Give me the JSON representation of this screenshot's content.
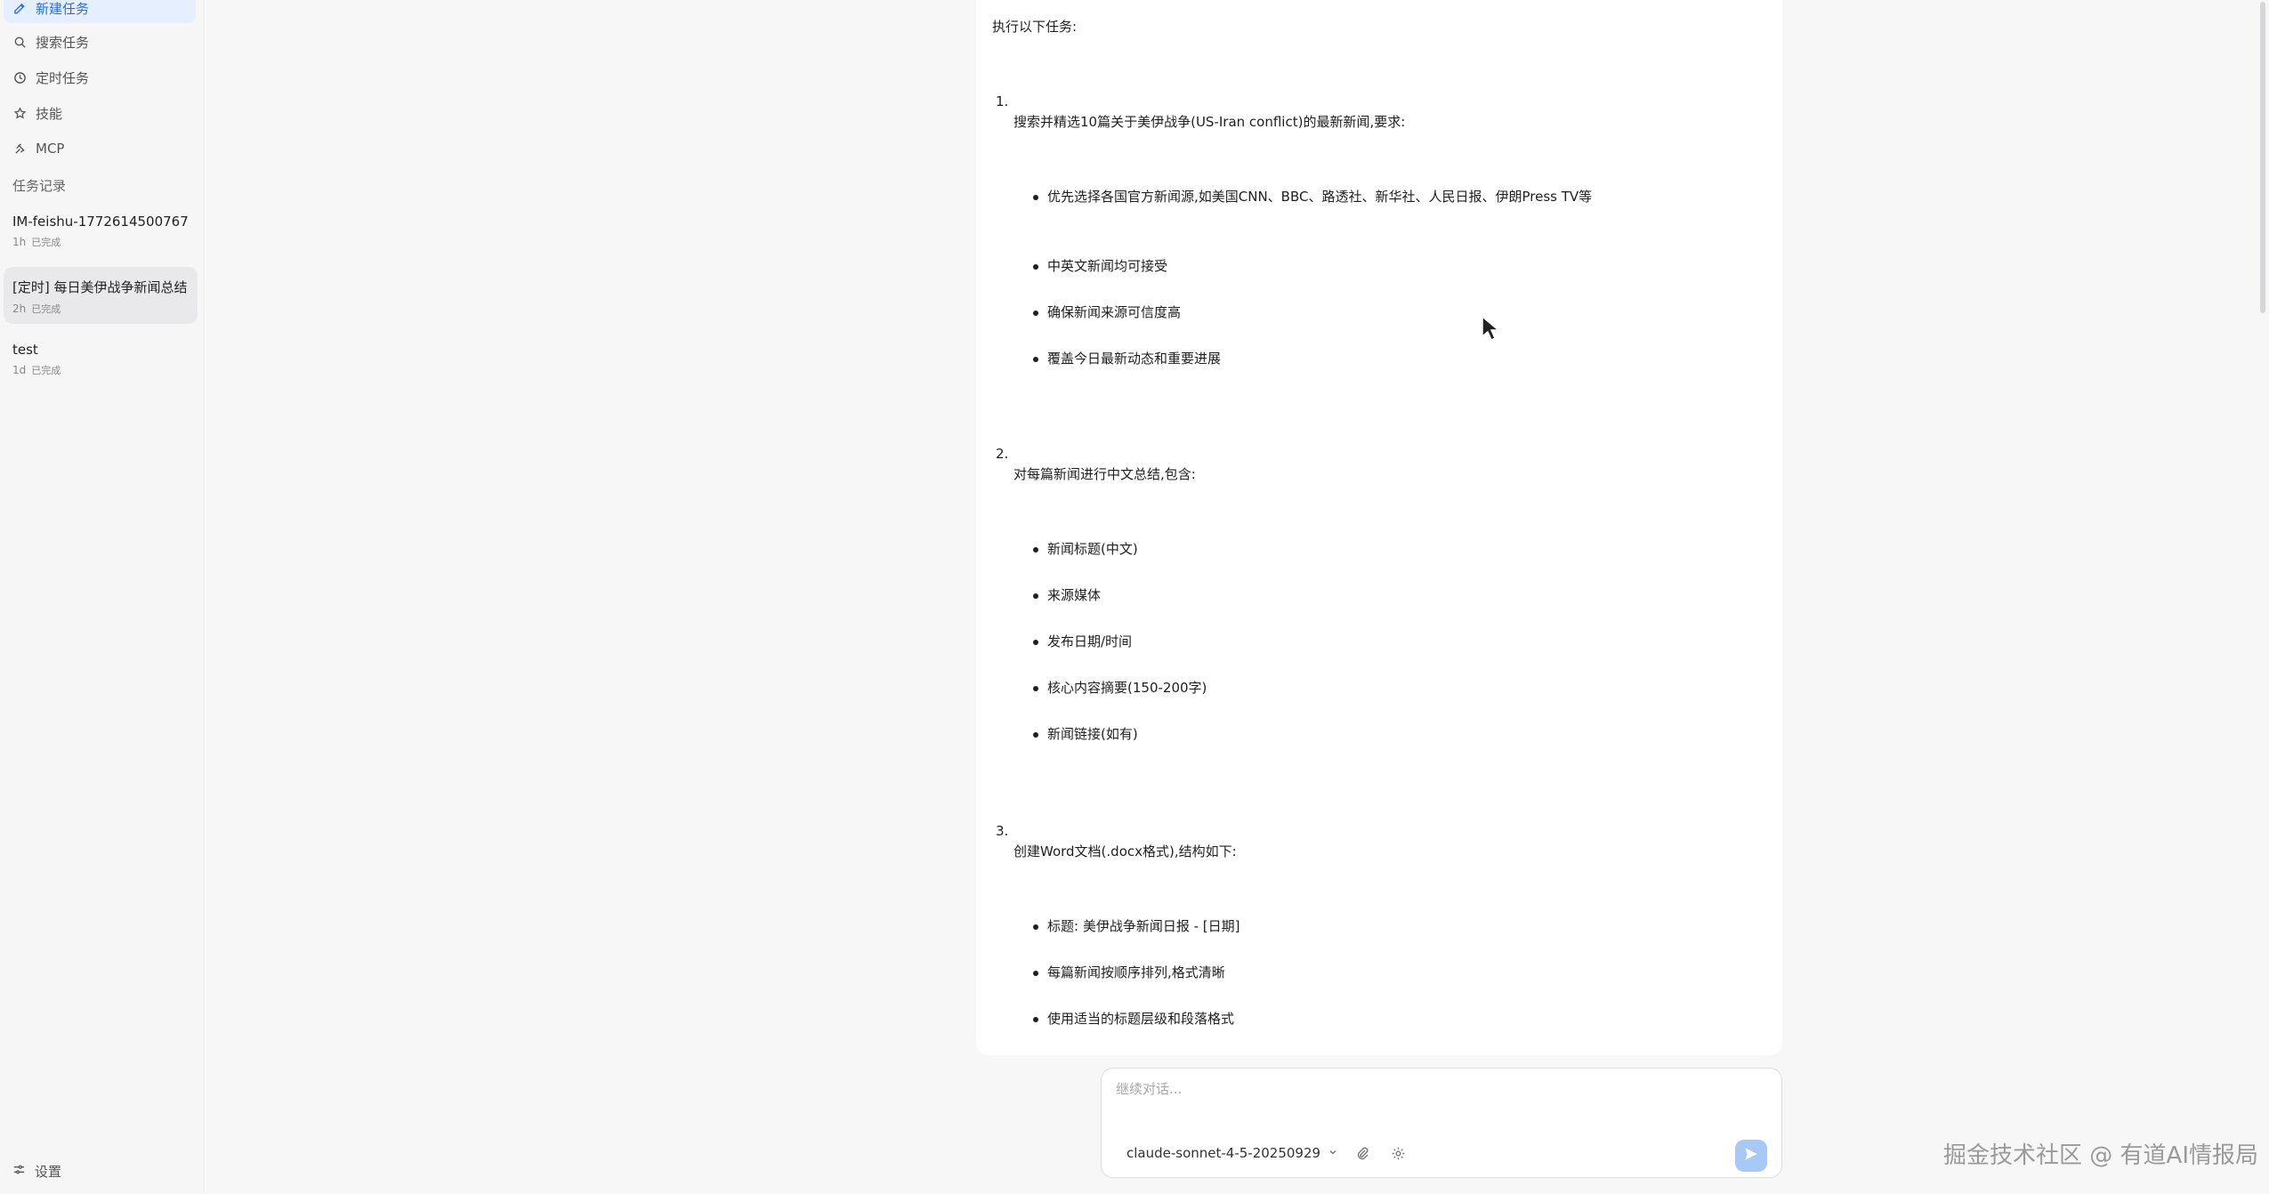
{
  "sidebar": {
    "nav": [
      {
        "label": "新建任务",
        "icon": "edit-icon"
      },
      {
        "label": "搜索任务",
        "icon": "search-icon"
      },
      {
        "label": "定时任务",
        "icon": "clock-icon"
      },
      {
        "label": "技能",
        "icon": "skill-icon"
      },
      {
        "label": "MCP",
        "icon": "mcp-icon"
      }
    ],
    "history_label": "任务记录",
    "history": [
      {
        "title": "IM-feishu-1772614500767",
        "age": "1h",
        "status": "已完成"
      },
      {
        "title": "[定时] 每日美伊战争新闻总结",
        "age": "2h",
        "status": "已完成"
      },
      {
        "title": "test",
        "age": "1d",
        "status": "已完成"
      }
    ],
    "settings_label": "设置"
  },
  "message": {
    "intro": "执行以下任务:",
    "tasks": [
      {
        "num": "1.",
        "head": "搜索并精选10篇关于美伊战争(US-Iran conflict)的最新新闻,要求:",
        "bullets": [
          "优先选择各国官方新闻源,如美国CNN、BBC、路透社、新华社、人民日报、伊朗Press TV等",
          "中英文新闻均可接受",
          "确保新闻来源可信度高",
          "覆盖今日最新动态和重要进展"
        ]
      },
      {
        "num": "2.",
        "head": "对每篇新闻进行中文总结,包含:",
        "bullets": [
          "新闻标题(中文)",
          "来源媒体",
          "发布日期/时间",
          "核心内容摘要(150-200字)",
          "新闻链接(如有)"
        ]
      },
      {
        "num": "3.",
        "head": "创建Word文档(.docx格式),结构如下:",
        "bullets": [
          "标题: 美伊战争新闻日报 - [日期]",
          "每篇新闻按顺序排列,格式清晰",
          "使用适当的标题层级和段落格式"
        ]
      }
    ]
  },
  "composer": {
    "placeholder": "继续对话...",
    "model": "claude-sonnet-4-5-20250929"
  },
  "watermark": "掘金技术社区 @ 有道AI情报局",
  "colors": {
    "accent": "#2f6fd6",
    "active_bg": "#e5effd",
    "send_button": "#a8c8f6"
  }
}
